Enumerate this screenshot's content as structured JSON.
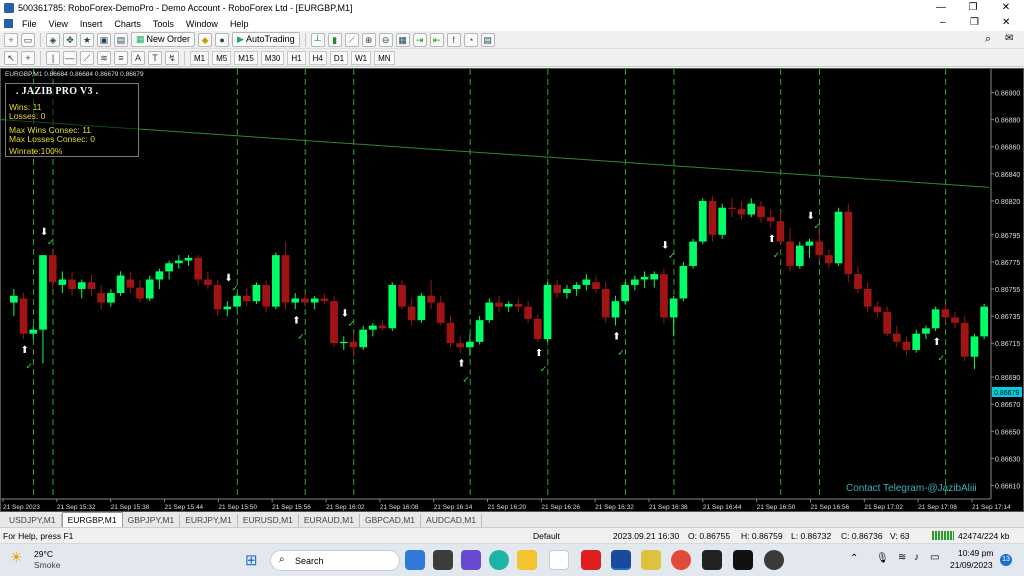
{
  "window": {
    "title": "500361785: RoboForex-DemoPro - Demo Account - RoboForex Ltd - [EURGBP,M1]"
  },
  "menu": [
    "File",
    "View",
    "Insert",
    "Charts",
    "Tools",
    "Window",
    "Help"
  ],
  "toolbar": {
    "new_order": "New Order",
    "autotrading": "AutoTrading"
  },
  "timeframes": [
    "M1",
    "M5",
    "M15",
    "M30",
    "H1",
    "H4",
    "D1",
    "W1",
    "MN"
  ],
  "chart": {
    "header": "EURGBP,M1 0.86684 0.86684 0.86679 0.86679",
    "current_price": "0.86679",
    "watermark": "Contact Telegram-@JazibAliii",
    "price_ticks": [
      "0.86900",
      "0.86880",
      "0.86860",
      "0.86840",
      "0.86820",
      "0.86795",
      "0.86775",
      "0.86755",
      "0.86735",
      "0.86715",
      "0.86690",
      "0.86670",
      "0.86650",
      "0.86630",
      "0.86610"
    ],
    "time_ticks": [
      "21 Sep 2023",
      "21 Sep 15:32",
      "21 Sep 15:38",
      "21 Sep 15:44",
      "21 Sep 15:50",
      "21 Sep 15:56",
      "21 Sep 16:02",
      "21 Sep 16:08",
      "21 Sep 16:14",
      "21 Sep 16:20",
      "21 Sep 16:26",
      "21 Sep 16:32",
      "21 Sep 16:38",
      "21 Sep 16:44",
      "21 Sep 16:50",
      "21 Sep 16:56",
      "21 Sep 17:02",
      "21 Sep 17:08",
      "21 Sep 17:14"
    ],
    "colors": {
      "bull": "#00ff66",
      "bear": "#a01414",
      "grid_line": "#2fa52f",
      "trendline": "#2e8b2e",
      "panel_text": "#e8d830"
    }
  },
  "panel": {
    "title": ".    JAZIB PRO V3    .",
    "wins": "Wins: 11",
    "losses": "Losses: 0",
    "max_wins": "Max Wins Consec: 11",
    "max_losses": "Max Losses Consec: 0",
    "winrate": "Winrate:100%"
  },
  "chart_data": {
    "type": "candlestick",
    "ylim": [
      0.866,
      0.8691
    ],
    "candles": [
      [
        0.86745,
        0.86755,
        0.86735,
        0.8675
      ],
      [
        0.86748,
        0.86752,
        0.86718,
        0.86722
      ],
      [
        0.86722,
        0.86728,
        0.86718,
        0.86725
      ],
      [
        0.86725,
        0.8678,
        0.867,
        0.8678
      ],
      [
        0.8678,
        0.86785,
        0.86755,
        0.8676
      ],
      [
        0.86758,
        0.86768,
        0.86752,
        0.86762
      ],
      [
        0.86762,
        0.86768,
        0.8675,
        0.86755
      ],
      [
        0.86755,
        0.86762,
        0.86748,
        0.8676
      ],
      [
        0.8676,
        0.86766,
        0.8675,
        0.86755
      ],
      [
        0.86752,
        0.86758,
        0.8674,
        0.86745
      ],
      [
        0.86745,
        0.86755,
        0.86742,
        0.86752
      ],
      [
        0.86752,
        0.86768,
        0.8675,
        0.86765
      ],
      [
        0.86762,
        0.86768,
        0.86752,
        0.86756
      ],
      [
        0.86756,
        0.86762,
        0.86745,
        0.86748
      ],
      [
        0.86748,
        0.86765,
        0.86746,
        0.86762
      ],
      [
        0.86762,
        0.8677,
        0.86755,
        0.86768
      ],
      [
        0.86768,
        0.86776,
        0.86762,
        0.86774
      ],
      [
        0.86774,
        0.8678,
        0.8677,
        0.86776
      ],
      [
        0.86776,
        0.8678,
        0.86772,
        0.86778
      ],
      [
        0.86778,
        0.8678,
        0.86758,
        0.86762
      ],
      [
        0.86762,
        0.86768,
        0.86755,
        0.86758
      ],
      [
        0.86758,
        0.86762,
        0.86735,
        0.8674
      ],
      [
        0.8674,
        0.86746,
        0.86735,
        0.86742
      ],
      [
        0.86742,
        0.86752,
        0.8674,
        0.8675
      ],
      [
        0.8675,
        0.86755,
        0.86742,
        0.86746
      ],
      [
        0.86746,
        0.8676,
        0.86744,
        0.86758
      ],
      [
        0.86758,
        0.86762,
        0.86738,
        0.86742
      ],
      [
        0.86742,
        0.86782,
        0.8674,
        0.8678
      ],
      [
        0.8678,
        0.8679,
        0.8674,
        0.86745
      ],
      [
        0.86745,
        0.86752,
        0.8674,
        0.86748
      ],
      [
        0.86748,
        0.86752,
        0.86742,
        0.86745
      ],
      [
        0.86745,
        0.8675,
        0.8674,
        0.86748
      ],
      [
        0.86748,
        0.86752,
        0.86744,
        0.86746
      ],
      [
        0.86746,
        0.8675,
        0.86712,
        0.86715
      ],
      [
        0.86715,
        0.8672,
        0.8671,
        0.86716
      ],
      [
        0.86716,
        0.86722,
        0.86705,
        0.86712
      ],
      [
        0.86712,
        0.86728,
        0.8671,
        0.86725
      ],
      [
        0.86725,
        0.8673,
        0.8672,
        0.86728
      ],
      [
        0.86728,
        0.86732,
        0.86724,
        0.86726
      ],
      [
        0.86726,
        0.8676,
        0.86724,
        0.86758
      ],
      [
        0.86758,
        0.86762,
        0.8674,
        0.86742
      ],
      [
        0.86742,
        0.86748,
        0.86728,
        0.86732
      ],
      [
        0.86732,
        0.86752,
        0.8673,
        0.8675
      ],
      [
        0.8675,
        0.86762,
        0.8674,
        0.86745
      ],
      [
        0.86745,
        0.8675,
        0.86728,
        0.8673
      ],
      [
        0.8673,
        0.86735,
        0.86712,
        0.86715
      ],
      [
        0.86715,
        0.8672,
        0.86708,
        0.86712
      ],
      [
        0.86712,
        0.86722,
        0.86706,
        0.86716
      ],
      [
        0.86716,
        0.86735,
        0.86714,
        0.86732
      ],
      [
        0.86732,
        0.86748,
        0.8673,
        0.86745
      ],
      [
        0.86745,
        0.8675,
        0.86738,
        0.86742
      ],
      [
        0.86742,
        0.86746,
        0.86738,
        0.86744
      ],
      [
        0.86744,
        0.86748,
        0.86738,
        0.86742
      ],
      [
        0.86742,
        0.86746,
        0.8673,
        0.86733
      ],
      [
        0.86733,
        0.86736,
        0.86716,
        0.86718
      ],
      [
        0.86718,
        0.8676,
        0.86716,
        0.86758
      ],
      [
        0.86758,
        0.86762,
        0.86748,
        0.86752
      ],
      [
        0.86752,
        0.86758,
        0.86748,
        0.86755
      ],
      [
        0.86755,
        0.8676,
        0.8675,
        0.86758
      ],
      [
        0.86758,
        0.86766,
        0.86754,
        0.86762
      ],
      [
        0.8676,
        0.86765,
        0.86752,
        0.86755
      ],
      [
        0.86755,
        0.8676,
        0.8673,
        0.86734
      ],
      [
        0.86734,
        0.8675,
        0.86728,
        0.86746
      ],
      [
        0.86746,
        0.8676,
        0.86744,
        0.86758
      ],
      [
        0.86758,
        0.86765,
        0.86754,
        0.86762
      ],
      [
        0.86762,
        0.86768,
        0.86756,
        0.86764
      ],
      [
        0.86762,
        0.86768,
        0.86756,
        0.86766
      ],
      [
        0.86766,
        0.8677,
        0.8673,
        0.86734
      ],
      [
        0.86734,
        0.8675,
        0.8672,
        0.86748
      ],
      [
        0.86748,
        0.86775,
        0.86746,
        0.86772
      ],
      [
        0.86772,
        0.86792,
        0.8677,
        0.8679
      ],
      [
        0.8679,
        0.86822,
        0.86788,
        0.8682
      ],
      [
        0.8682,
        0.86824,
        0.8679,
        0.86795
      ],
      [
        0.86795,
        0.86818,
        0.86792,
        0.86815
      ],
      [
        0.86815,
        0.86822,
        0.86808,
        0.86814
      ],
      [
        0.86814,
        0.8682,
        0.86806,
        0.8681
      ],
      [
        0.8681,
        0.86822,
        0.86808,
        0.86818
      ],
      [
        0.86816,
        0.8682,
        0.86804,
        0.86808
      ],
      [
        0.86808,
        0.86814,
        0.868,
        0.86805
      ],
      [
        0.86805,
        0.86812,
        0.86788,
        0.8679
      ],
      [
        0.8679,
        0.868,
        0.86768,
        0.86772
      ],
      [
        0.86772,
        0.8679,
        0.8677,
        0.86787
      ],
      [
        0.86787,
        0.86792,
        0.86778,
        0.8679
      ],
      [
        0.8679,
        0.86802,
        0.86775,
        0.8678
      ],
      [
        0.8678,
        0.86784,
        0.8677,
        0.86774
      ],
      [
        0.86774,
        0.86815,
        0.86772,
        0.86812
      ],
      [
        0.86812,
        0.86818,
        0.8676,
        0.86766
      ],
      [
        0.86766,
        0.86772,
        0.86752,
        0.86755
      ],
      [
        0.86755,
        0.8676,
        0.86738,
        0.86742
      ],
      [
        0.86742,
        0.86746,
        0.86734,
        0.86738
      ],
      [
        0.86738,
        0.86742,
        0.8672,
        0.86722
      ],
      [
        0.86722,
        0.86728,
        0.86712,
        0.86716
      ],
      [
        0.86716,
        0.8672,
        0.86706,
        0.8671
      ],
      [
        0.8671,
        0.86725,
        0.86708,
        0.86722
      ],
      [
        0.86722,
        0.86728,
        0.86718,
        0.86726
      ],
      [
        0.86726,
        0.86742,
        0.86724,
        0.8674
      ],
      [
        0.8674,
        0.86744,
        0.8673,
        0.86734
      ],
      [
        0.86734,
        0.86738,
        0.86726,
        0.8673
      ],
      [
        0.8673,
        0.86735,
        0.86702,
        0.86705
      ],
      [
        0.86705,
        0.86722,
        0.86696,
        0.8672
      ],
      [
        0.8672,
        0.86744,
        0.86718,
        0.86742
      ]
    ],
    "vertical_lines_px": [],
    "up_arrow_candles": [
      1,
      29,
      46,
      54,
      62,
      78,
      95
    ],
    "down_arrow_candles": [
      3,
      22,
      34,
      67,
      82
    ]
  },
  "tabs": [
    "USDJPY,M1",
    "EURGBP,M1",
    "GBPJPY,M1",
    "EURJPY,M1",
    "EURUSD,M1",
    "EURAUD,M1",
    "GBPCAD,M1",
    "AUDCAD,M1"
  ],
  "status": {
    "help": "For Help, press F1",
    "profile": "Default",
    "datetime": "2023.09.21 16:30",
    "open": "O: 0.86755",
    "high": "H: 0.86759",
    "low": "L: 0.86732",
    "close": "C: 0.86736",
    "volume": "V: 63",
    "traffic": "42474/224 kb"
  },
  "taskbar": {
    "weather_temp": "29°C",
    "weather_desc": "Smoke",
    "search": "Search",
    "time": "10:49 pm",
    "date": "21/09/2023",
    "notif": "13"
  }
}
